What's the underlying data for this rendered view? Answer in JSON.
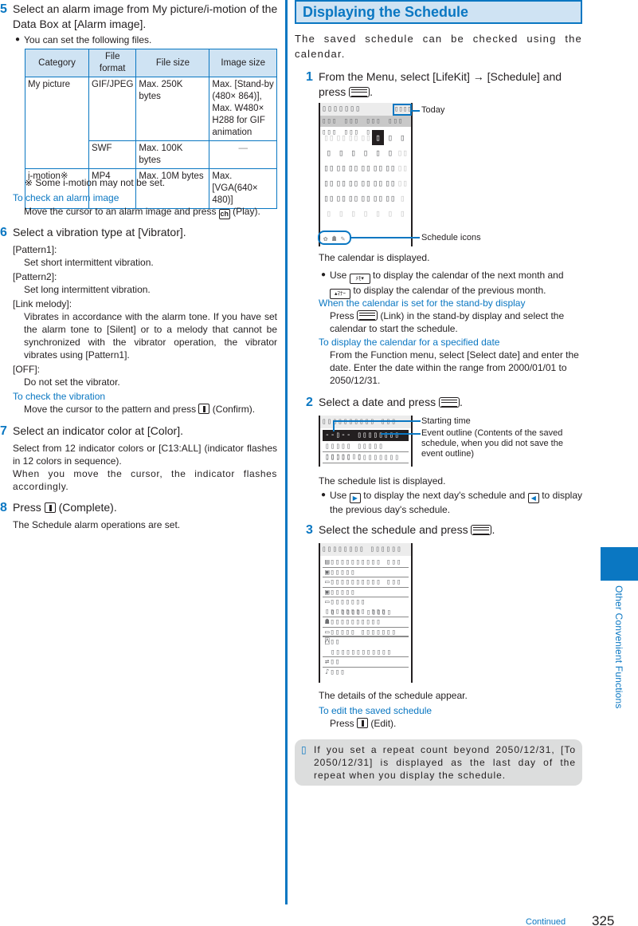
{
  "left": {
    "step5": {
      "num": "5",
      "text": "Select an alarm image from My picture/i-motion of the Data Box at [Alarm image].",
      "bullet": "You can set the following files.",
      "table": {
        "headers": [
          "Category",
          "File format",
          "File size",
          "Image size"
        ],
        "rows": [
          {
            "category": "My picture",
            "format": "GIF/JPEG",
            "size": "Max. 250K bytes",
            "image": "Max. [Stand-by (480× 864)], Max. W480× H288 for GIF animation"
          },
          {
            "category": "",
            "format": "SWF",
            "size": "Max. 100K bytes",
            "image": "—"
          },
          {
            "category": "i-motion※",
            "format": "MP4",
            "size": "Max. 10M bytes",
            "image": "Max. [VGA(640× 480)]"
          }
        ]
      },
      "footnote": "※ Some i-motion may not be set.",
      "sub_title": "To check an alarm image",
      "sub_text_before": "Move the cursor to an alarm image and press ",
      "sub_key": "ch",
      "sub_text_after": " (Play)."
    },
    "step6": {
      "num": "6",
      "text": "Select a vibration type at [Vibrator].",
      "options": [
        {
          "term": "[Pattern1]:",
          "desc": "Set short intermittent vibration."
        },
        {
          "term": "[Pattern2]:",
          "desc": "Set long intermittent vibration."
        },
        {
          "term": "[Link melody]:",
          "desc": "Vibrates in accordance with the alarm tone. If you have set the alarm tone to [Silent] or to a melody that cannot be synchronized with the vibrator operation, the vibrator vibrates using [Pattern1]."
        },
        {
          "term": "[OFF]:",
          "desc": "Do not set the vibrator."
        }
      ],
      "sub_title": "To check the vibration",
      "sub_text_before": "Move the cursor to the pattern and press ",
      "sub_text_after": " (Confirm)."
    },
    "step7": {
      "num": "7",
      "text": "Select an indicator color at [Color].",
      "body1": "Select from 12 indicator colors or [C13:ALL] (indicator flashes in 12 colors in sequence).",
      "body2": "When you move the cursor, the indicator flashes accordingly."
    },
    "step8": {
      "num": "8",
      "text_before": "Press ",
      "text_after": " (Complete).",
      "body": "The Schedule alarm operations are set."
    }
  },
  "right": {
    "section_title": "Displaying the Schedule",
    "intro": "The saved schedule can be checked using the calendar.",
    "step1": {
      "num": "1",
      "text_before": "From the Menu, select [LifeKit] → [Schedule] and press ",
      "text_after": ".",
      "screen": {
        "header_left": "▯▯▯▯▯▯▯",
        "header_right": "▯▯▯▯",
        "weekdays": "▯▯▯ ▯▯▯ ▯▯▯ ▯▯▯ ▯▯▯ ▯▯▯ ▯▯▯",
        "callout_today": "Today",
        "callout_icons": "Schedule icons",
        "icons": [
          "schedule-icon-1",
          "schedule-icon-2",
          "schedule-icon-3"
        ]
      },
      "caption": "The calendar is displayed.",
      "bullet_before": "Use ",
      "bullet_key1": "ﾒﾓ▾",
      "bullet_mid1": " to display the calendar of the next month and ",
      "bullet_key2": "▴ﾏﾅｰ",
      "bullet_after": " to display the calendar of the previous month.",
      "sub1_title": "When the calendar is set for the stand-by display",
      "sub1_before": "Press ",
      "sub1_after": " (Link) in the stand-by display and select the calendar to start the schedule.",
      "sub2_title": "To display the calendar for a specified date",
      "sub2_text": "From the Function menu, select [Select date] and enter the date. Enter the date within the range from 2000/01/01 to 2050/12/31."
    },
    "step2": {
      "num": "2",
      "text_before": "Select a date and press ",
      "text_after": ".",
      "screen": {
        "header": "▯▯▯▯▯▯▯▯▯▯ ▯▯▯",
        "rows": [
          "--▯-- ▯▯▯▯▯▯▯▯",
          "▯▯▯▯▯ ▯▯▯▯▯ ▯▯▯▯▯▯▯",
          "▯▯▯▯▯ ▯▯▯▯▯▯▯▯"
        ],
        "callout_start": "Starting time",
        "callout_outline": "Event outline (Contents of the saved schedule, when you did not save the event outline)"
      },
      "caption": "The schedule list is displayed.",
      "bullet_before": "Use ",
      "bullet_mid": " to display the next day's schedule and ",
      "bullet_after": " to display the previous day's schedule."
    },
    "step3": {
      "num": "3",
      "text_before": "Select the schedule and press ",
      "text_after": ".",
      "screen": {
        "header": "▯▯▯▯▯▯▯▯ ▯▯▯▯▯▯",
        "rows": [
          "▯▯▯▯▯▯▯▯▯▯ ▯▯▯",
          "▯▯▯▯▯",
          "▯▯▯▯▯▯▯▯▯▯ ▯▯▯",
          "▯▯▯▯▯",
          "▯▯▯▯▯▯▯ ▯▯▯▯▯▯▯▯ ▯▯▯",
          "▯ ▯▯▯▯ ▯▯▯▯▯",
          "▯▯▯▯▯▯▯▯▯▯",
          "▯▯▯▯▯ ▯▯▯▯▯▯▯",
          "▯▯",
          "▯▯▯▯▯▯▯▯▯▯▯▯",
          "▯▯",
          "▯▯▯"
        ]
      },
      "caption": "The details of the schedule appear.",
      "sub_title": "To edit the saved schedule",
      "sub_before": "Press ",
      "sub_after": " (Edit)."
    },
    "note": "If you set a repeat count beyond 2050/12/31, [To 2050/12/31] is displayed as the last day of the repeat when you display the schedule.",
    "note_icon": "▯"
  },
  "side_tab": "Other Convenient Functions",
  "footer": {
    "continued": "Continued",
    "page": "325"
  },
  "colors": {
    "accent": "#0a77c2",
    "header_fill": "#cfe3f3",
    "note_fill": "#dcdddd"
  }
}
